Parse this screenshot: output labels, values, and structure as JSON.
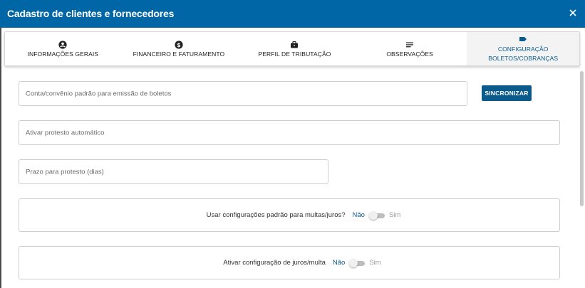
{
  "window": {
    "title": "Cadastro de clientes e fornecedores",
    "close_icon": "close-icon"
  },
  "tabs": [
    {
      "label": "INFORMAÇÕES GERAIS",
      "icon": "account-circle-icon",
      "active": false
    },
    {
      "label": "FINANCEIRO E FATURAMENTO",
      "icon": "dollar-circle-icon",
      "active": false
    },
    {
      "label": "PERFIL DE TRIBUTAÇÃO",
      "icon": "briefcase-icon",
      "active": false
    },
    {
      "label": "OBSERVAÇÕES",
      "icon": "notes-lines-icon",
      "active": false
    },
    {
      "label_line1": "CONFIGURAÇÃO",
      "label_line2": "BOLETOS/COBRANÇAS",
      "icon": "tag-icon",
      "active": true
    }
  ],
  "form": {
    "account_placeholder": "Conta/convênio padrão para emissão de boletos",
    "sync_button": "SINCRONIZAR",
    "protest_placeholder": "Ativar protesto automático",
    "protest_days_placeholder": "Prazo para protesto (dias)",
    "defaults_question": "Usar configurações padrão para multas/juros?",
    "defaults_no": "Não",
    "defaults_yes": "Sim",
    "interest_question": "Ativar configuração de juros/multa",
    "interest_no": "Não",
    "interest_yes": "Sim"
  },
  "colors": {
    "header": "#0066a6",
    "accent": "#0a5a8c"
  }
}
